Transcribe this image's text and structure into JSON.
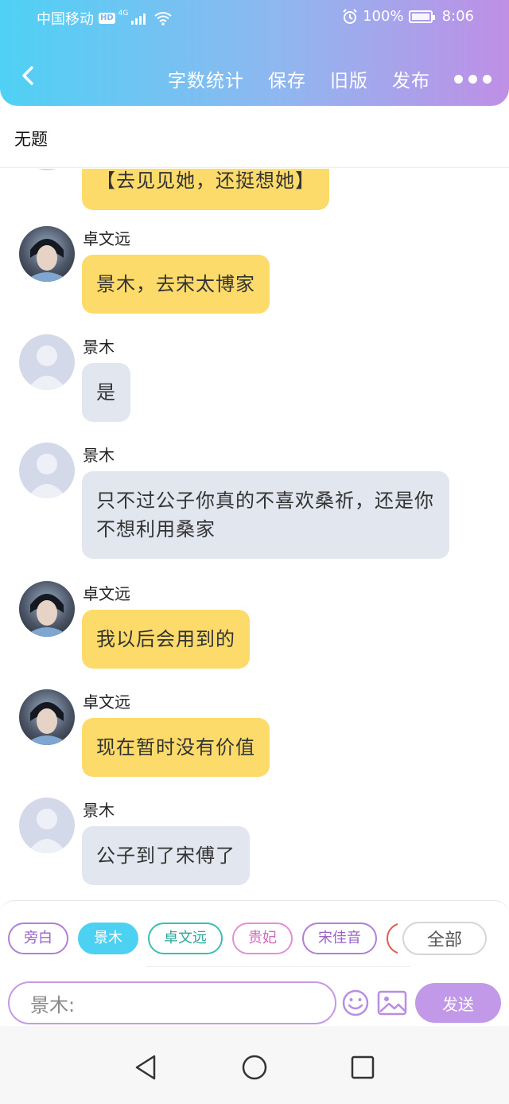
{
  "status_bar": {
    "carrier": "中国移动",
    "hd": "HD",
    "network": "4G",
    "battery_percent": "100%",
    "time": "8:06"
  },
  "nav": {
    "actions": [
      "字数统计",
      "保存",
      "旧版",
      "发布"
    ]
  },
  "document": {
    "title": "无题"
  },
  "messages": [
    {
      "sender": "",
      "text": "【去见见她，还挺想她】",
      "style": "yellow"
    },
    {
      "sender": "卓文远",
      "text": "景木，去宋太博家",
      "style": "yellow"
    },
    {
      "sender": "景木",
      "text": "是",
      "style": "gray"
    },
    {
      "sender": "景木",
      "text": "只不过公子你真的不喜欢桑祈，还是你不想利用桑家",
      "style": "gray"
    },
    {
      "sender": "卓文远",
      "text": "我以后会用到的",
      "style": "yellow"
    },
    {
      "sender": "卓文远",
      "text": "现在暂时没有价值",
      "style": "yellow"
    },
    {
      "sender": "景木",
      "text": "公子到了宋傅了",
      "style": "gray"
    }
  ],
  "roles": {
    "chips": [
      "旁白",
      "景木",
      "卓文远",
      "贵妃",
      "宋佳音"
    ],
    "selected": "景木",
    "all_label": "全部"
  },
  "composer": {
    "value": "景木:",
    "send_label": "发送"
  },
  "colors": {
    "header_start": "#4fd1f5",
    "header_end": "#bf8fe6",
    "bubble_yellow": "#fddb6a",
    "bubble_gray": "#e2e6ef",
    "send": "#c299e8"
  }
}
